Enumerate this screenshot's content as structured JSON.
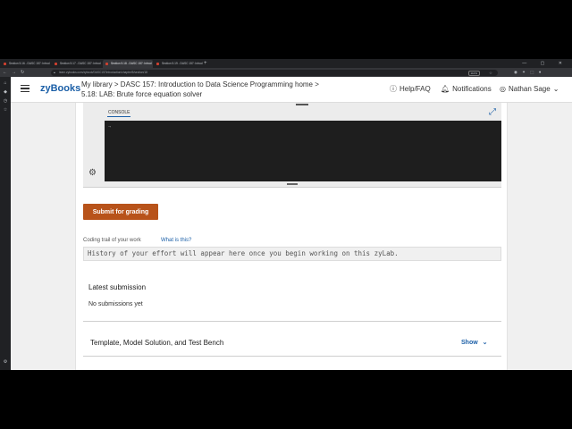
{
  "browser": {
    "tabs": [
      {
        "label": "Section 5.16 - DASC 157: Introd"
      },
      {
        "label": "Section 5.17 - DASC 157: Introd"
      },
      {
        "label": "Section 5.18 - DASC 157: Introd"
      },
      {
        "label": "Section 5.19 - DASC 157: Introd"
      }
    ],
    "new_tab": "+",
    "url": "learn.zybooks.com/zybook/DASC157Introduction/chapter/5/section/18",
    "zoom": "110%"
  },
  "header": {
    "logo": "zyBooks",
    "breadcrumb_line1": "My library  >  DASC 157: Introduction to Data Science Programming home  >",
    "breadcrumb_line2": "5.18: LAB: Brute force equation solver",
    "help_label": "Help/FAQ",
    "notifications_label": "Notifications",
    "user_name": "Nathan Sage"
  },
  "ide": {
    "console_tab": "CONSOLE",
    "prompt": "→"
  },
  "submit_label": "Submit for grading",
  "coding_trail": {
    "label": "Coding trail of your work",
    "link": "What is this?",
    "placeholder": "History of your effort will appear here once you begin working on this zyLab."
  },
  "latest_submission": {
    "title": "Latest submission",
    "status": "No submissions yet"
  },
  "template_section": {
    "title": "Template, Model Solution, and Test Bench",
    "toggle": "Show"
  },
  "colors": {
    "brand": "#1b5fa7",
    "submit": "#b8531a"
  }
}
